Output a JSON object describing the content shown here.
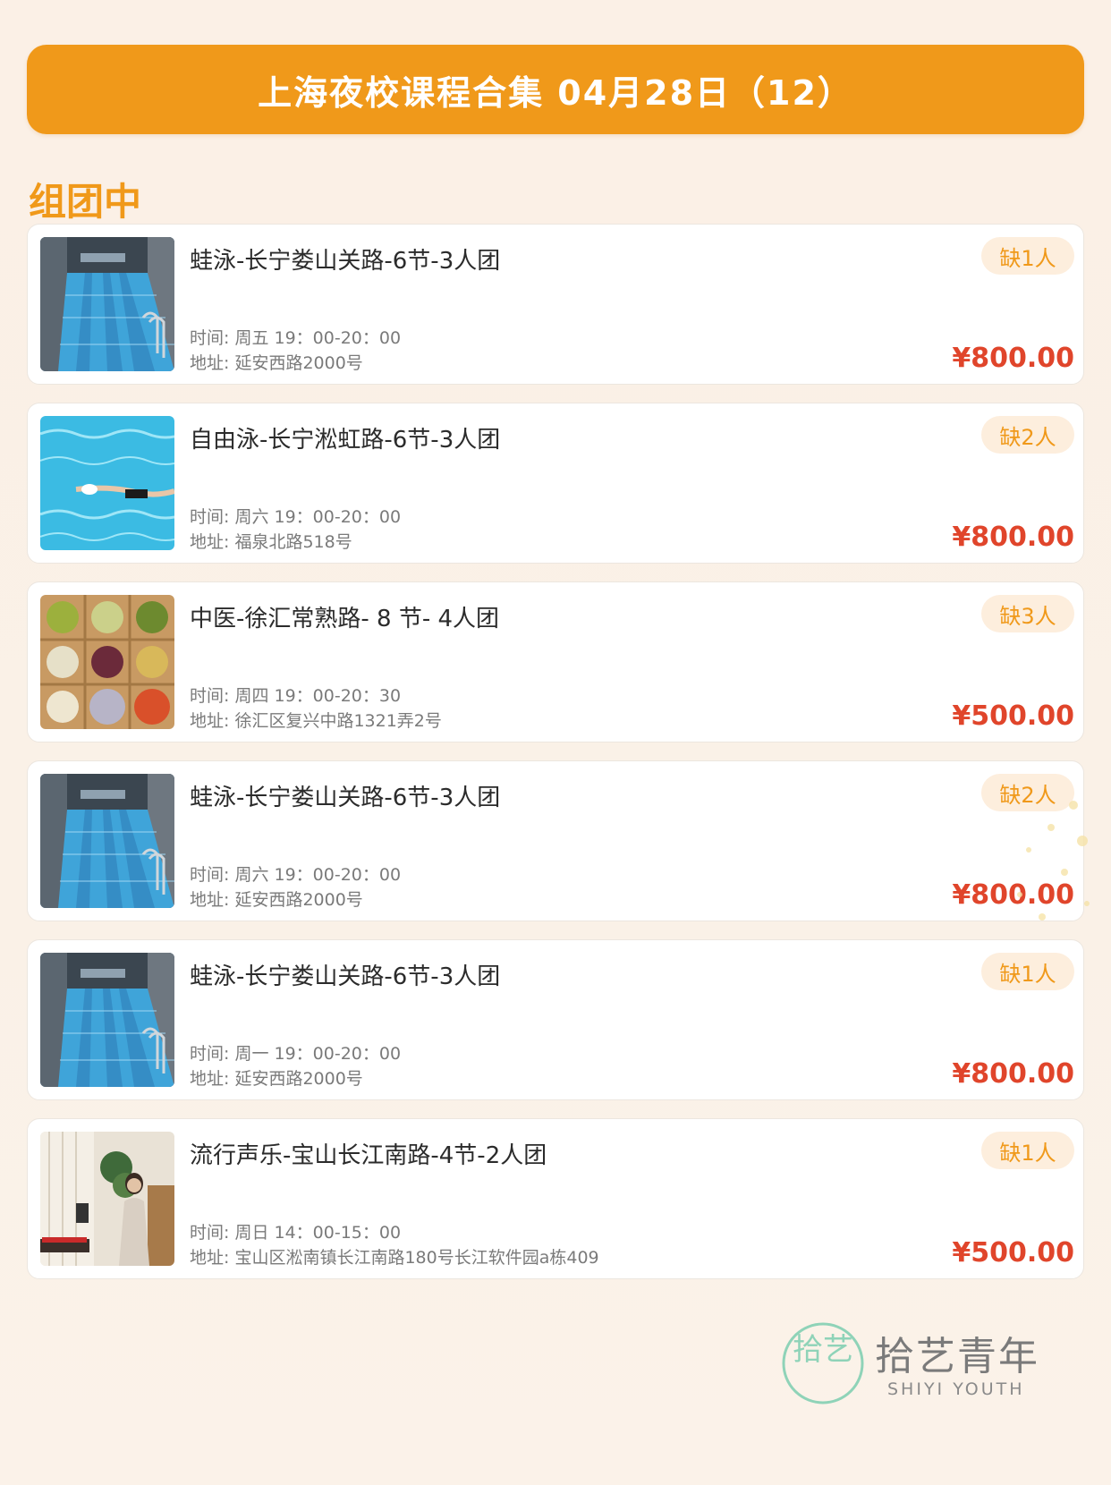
{
  "header": {
    "title": "上海夜校课程合集 04月28日（12）"
  },
  "section": {
    "title": "组团中"
  },
  "courses": [
    {
      "title": "蛙泳-长宁娄山关路-6节-3人团",
      "time": "时间: 周五 19：00-20：00",
      "address": "地址: 延安西路2000号",
      "badge": "缺1人",
      "price": "¥800.00",
      "image": "indoor-pool"
    },
    {
      "title": "自由泳-长宁淞虹路-6节-3人团",
      "time": "时间: 周六 19：00-20：00",
      "address": "地址: 福泉北路518号",
      "badge": "缺2人",
      "price": "¥800.00",
      "image": "swimmer"
    },
    {
      "title": "中医-徐汇常熟路- 8 节- 4人团",
      "time": "时间: 周四 19：00-20：30",
      "address": "地址: 徐汇区复兴中路1321弄2号",
      "badge": "缺3人",
      "price": "¥500.00",
      "image": "herbs"
    },
    {
      "title": "蛙泳-长宁娄山关路-6节-3人团",
      "time": "时间: 周六 19：00-20：00",
      "address": "地址: 延安西路2000号",
      "badge": "缺2人",
      "price": "¥800.00",
      "image": "indoor-pool"
    },
    {
      "title": "蛙泳-长宁娄山关路-6节-3人团",
      "time": "时间: 周一 19：00-20：00",
      "address": "地址: 延安西路2000号",
      "badge": "缺1人",
      "price": "¥800.00",
      "image": "indoor-pool"
    },
    {
      "title": "流行声乐-宝山长江南路-4节-2人团",
      "time": "时间: 周日 14：00-15：00",
      "address": "地址: 宝山区淞南镇长江南路180号长江软件园a栋409",
      "badge": "缺1人",
      "price": "¥500.00",
      "image": "singer"
    }
  ],
  "brand": {
    "name_cn": "拾艺青年",
    "name_en": "SHIYI YOUTH",
    "mark_text": "拾艺",
    "mark_color": "#8fd3b8"
  },
  "colors": {
    "accent": "#f0991a",
    "price": "#e0452b",
    "badge_bg": "#fdeedd"
  }
}
